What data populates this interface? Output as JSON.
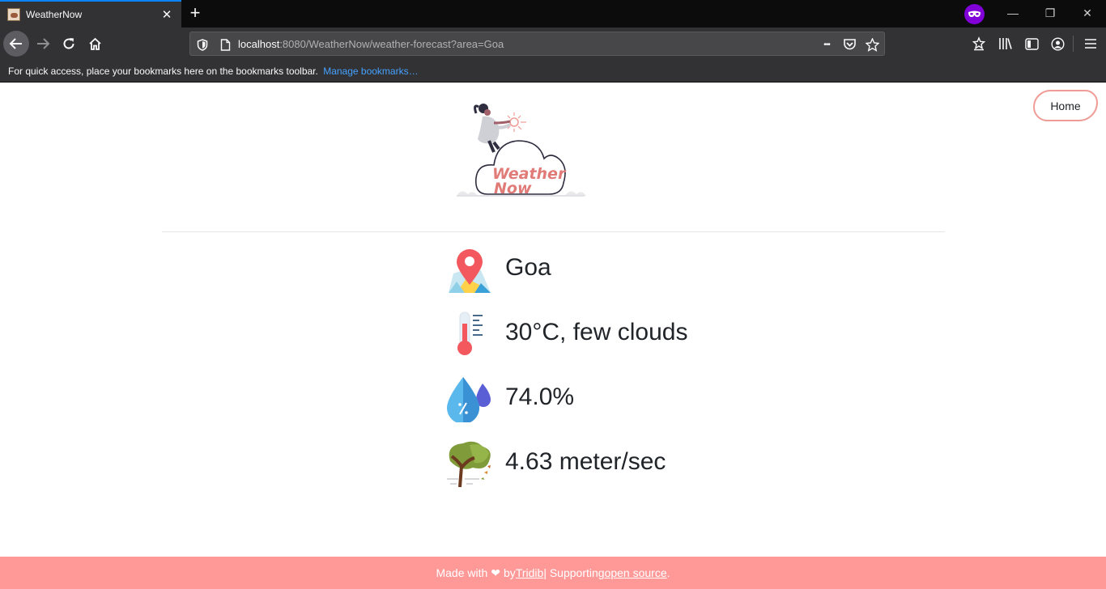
{
  "browser": {
    "tab_title": "WeatherNow",
    "tab_close_glyph": "✕",
    "new_tab_glyph": "+",
    "url_host": "localhost",
    "url_rest": ":8080/WeatherNow/weather-forecast?area=Goa",
    "url_more_glyph": "•••",
    "window_controls": {
      "minimize": "—",
      "restore": "❐",
      "close": "✕"
    },
    "bookmarks_message": "For quick access, place your bookmarks here on the bookmarks toolbar.",
    "bookmarks_link": "Manage bookmarks…",
    "colors": {
      "accent": "#0a84ff",
      "private": "#8000d7",
      "chrome_dark": "#0c0c0d",
      "chrome": "#323234"
    }
  },
  "page": {
    "home_button": "Home",
    "logo_text_line1": "Weather",
    "logo_text_line2": "Now",
    "weather": {
      "location": "Goa",
      "temperature": "30°C, few clouds",
      "humidity": "74.0%",
      "wind": "4.63 meter/sec"
    },
    "icons": [
      "map-pin-icon",
      "thermometer-icon",
      "water-drops-icon",
      "windy-tree-icon"
    ],
    "footer": {
      "made_with": "Made with",
      "heart": "❤",
      "by": "by",
      "author_link": "Tridib",
      "separator": "| Supporting",
      "open_source_link": "open source",
      "period": "."
    },
    "colors": {
      "brand": "#ff9998",
      "logo_text": "#e07b78",
      "text": "#212529"
    }
  }
}
